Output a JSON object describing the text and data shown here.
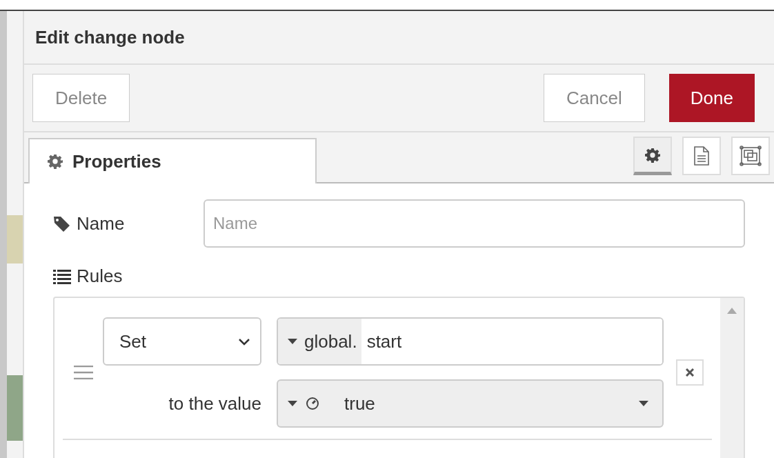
{
  "dialog": {
    "title": "Edit change node",
    "buttons": [
      {
        "label": "Delete",
        "kind": "secondary"
      },
      {
        "label": "Cancel",
        "kind": "secondary"
      },
      {
        "label": "Done",
        "kind": "primary"
      }
    ],
    "tabs": [
      {
        "label": "Properties",
        "selected": true
      }
    ],
    "tab_tools": [
      {
        "kind": "gear",
        "selected": true
      },
      {
        "kind": "doc",
        "selected": false
      },
      {
        "kind": "frame",
        "selected": false
      }
    ],
    "name_field": {
      "label": "Name",
      "placeholder": "Name"
    },
    "rules_label": "Rules",
    "rules": [
      {
        "action": "Set",
        "property_prefix": "global.",
        "property": "start",
        "value_label": "to the value",
        "value": "true"
      }
    ]
  }
}
